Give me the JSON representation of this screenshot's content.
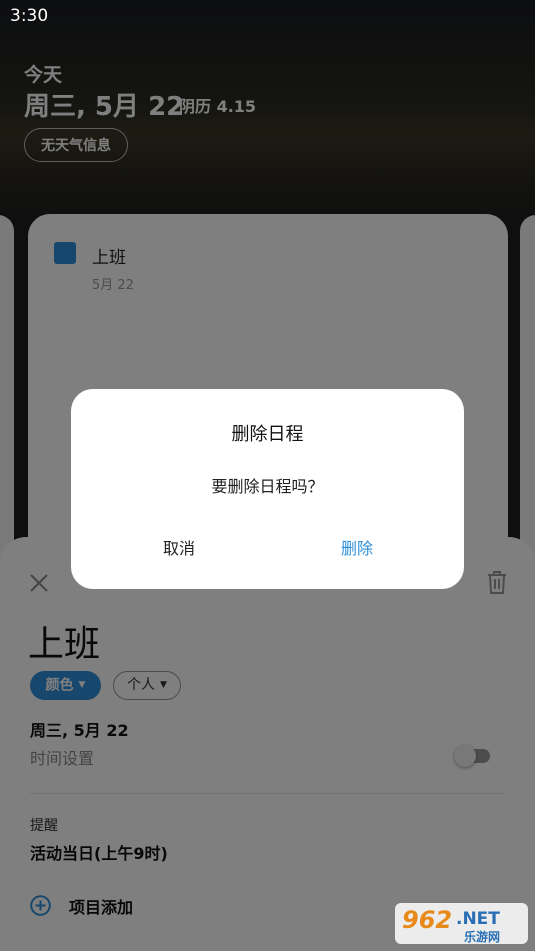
{
  "status_bar": {
    "time": "3:30"
  },
  "header": {
    "today_label": "今天",
    "date": "周三, 5月 22",
    "lunar": "阴历 4.15",
    "weather_button": "无天气信息"
  },
  "event_card": {
    "title": "上班",
    "date": "5月 22",
    "accent_color": "#2f8fd8"
  },
  "detail_sheet": {
    "title": "上班",
    "color_chip": "颜色",
    "calendar_chip": "个人",
    "date": "周三, 5月 22",
    "time_setting": "时间设置",
    "time_toggle_on": false,
    "reminder_label": "提醒",
    "reminder_value": "活动当日(上午9时)",
    "add_item": "项目添加"
  },
  "dialog": {
    "title": "删除日程",
    "message": "要删除日程吗？",
    "cancel": "取消",
    "delete": "删除"
  },
  "watermark": {
    "brand_number": "962",
    "brand_suffix": ".NET",
    "brand_text": "乐游网"
  },
  "icons": [
    "close-icon",
    "trash-icon",
    "plus-circle-icon",
    "caret-down-icon"
  ]
}
